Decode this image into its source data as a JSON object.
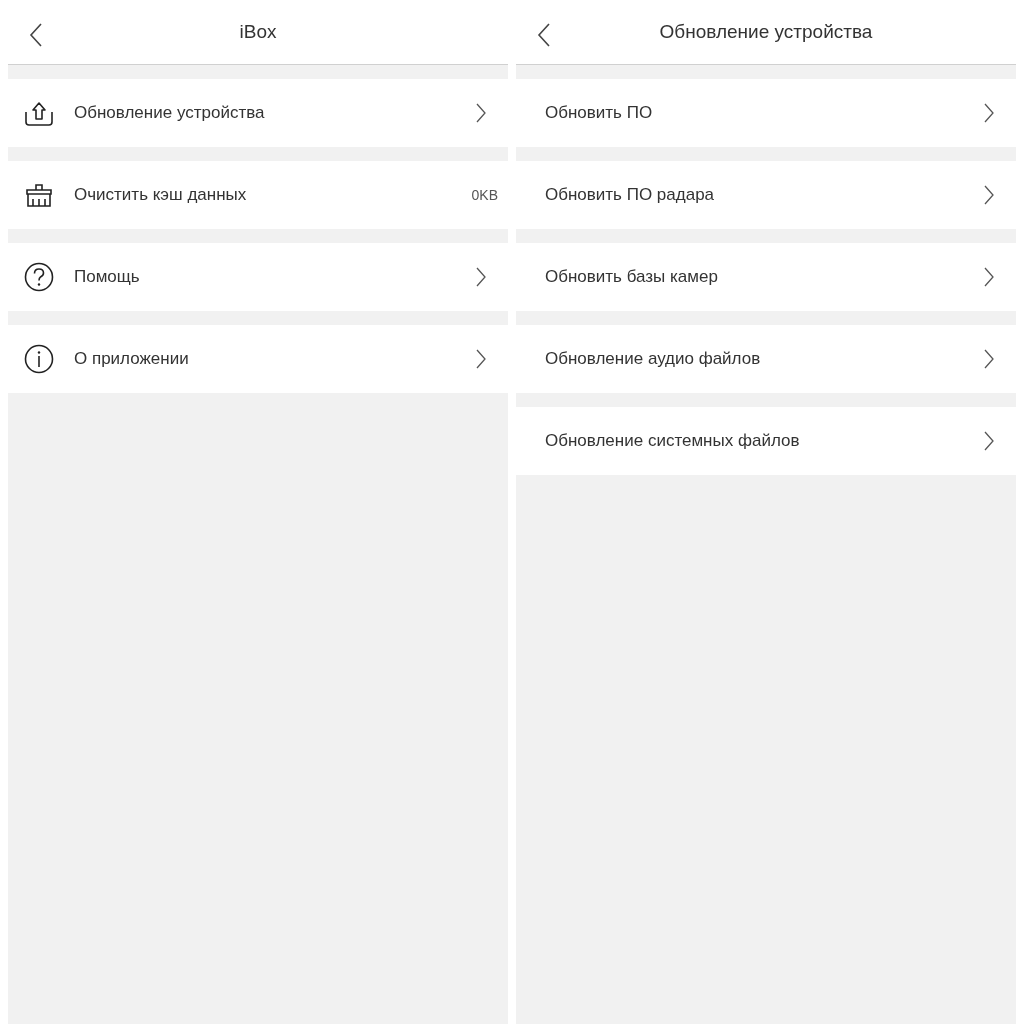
{
  "screens": [
    {
      "title": "iBox",
      "items": [
        {
          "kind": "link",
          "label": "Обновление устройства"
        },
        {
          "kind": "value",
          "label": "Очистить кэш данных",
          "value": "0KB"
        },
        {
          "kind": "link",
          "label": "Помощь"
        },
        {
          "kind": "link",
          "label": "О приложении"
        }
      ]
    },
    {
      "title": "Обновление устройства",
      "items": [
        {
          "kind": "link",
          "label": "Обновить ПО"
        },
        {
          "kind": "link",
          "label": "Обновить ПО радара"
        },
        {
          "kind": "link",
          "label": "Обновить базы камер"
        },
        {
          "kind": "link",
          "label": "Обновление аудио файлов"
        },
        {
          "kind": "link",
          "label": "Обновление системных файлов"
        }
      ]
    }
  ]
}
